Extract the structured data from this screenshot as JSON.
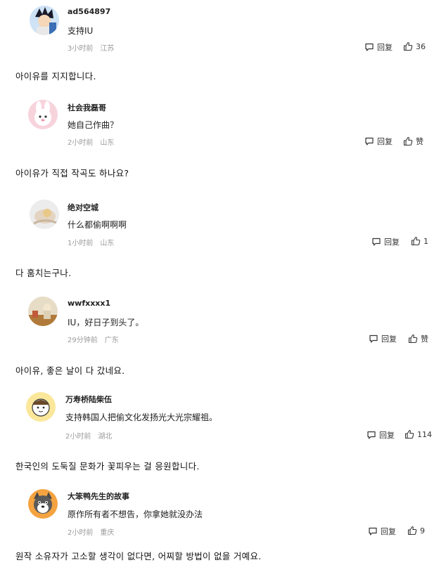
{
  "comments": [
    {
      "username": "ad564897",
      "text": "支持IU",
      "time": "3小时前",
      "location": "江苏",
      "reply_label": "回复",
      "likes": "36",
      "translation": "아이유를 지지합니다."
    },
    {
      "username": "社会我磊哥",
      "text": "她自己作曲？",
      "time": "2小时前",
      "location": "山东",
      "reply_label": "回复",
      "likes": "赞",
      "translation": "아이유가 직접 작곡도 하나요?"
    },
    {
      "username": "绝对空城",
      "text": "什么都偷啊啊啊",
      "time": "1小时前",
      "location": "山东",
      "reply_label": "回复",
      "likes": "1",
      "translation": "다 훔치는구나."
    },
    {
      "username": "wwfxxxx1",
      "text": "IU，好日子到头了。",
      "time": "29分钟前",
      "location": "广东",
      "reply_label": "回复",
      "likes": "赞",
      "translation": "아이유, 좋은 날이 다 갔네요."
    },
    {
      "username": "万寿桥陆柴伍",
      "text": "支持韩国人把偷文化发扬光大光宗耀祖。",
      "time": "2小时前",
      "location": "湖北",
      "reply_label": "回复",
      "likes": "114",
      "translation": "한국인의 도둑질 문화가 꽃피우는 걸 응원합니다."
    },
    {
      "username": "大笨鸭先生的故事",
      "text": "原作所有者不想告，你拿她就没办法",
      "time": "2小时前",
      "location": "重庆",
      "reply_label": "回复",
      "likes": "9",
      "translation": "원작 소유자가 고소할 생각이 없다면, 어찌할 방법이 없을 거예요."
    }
  ],
  "icons": {
    "reply": "comment-bubble-icon",
    "like": "thumbs-up-icon"
  },
  "colors": {
    "meta_gray": "#9a9a9a",
    "text": "#222222"
  }
}
